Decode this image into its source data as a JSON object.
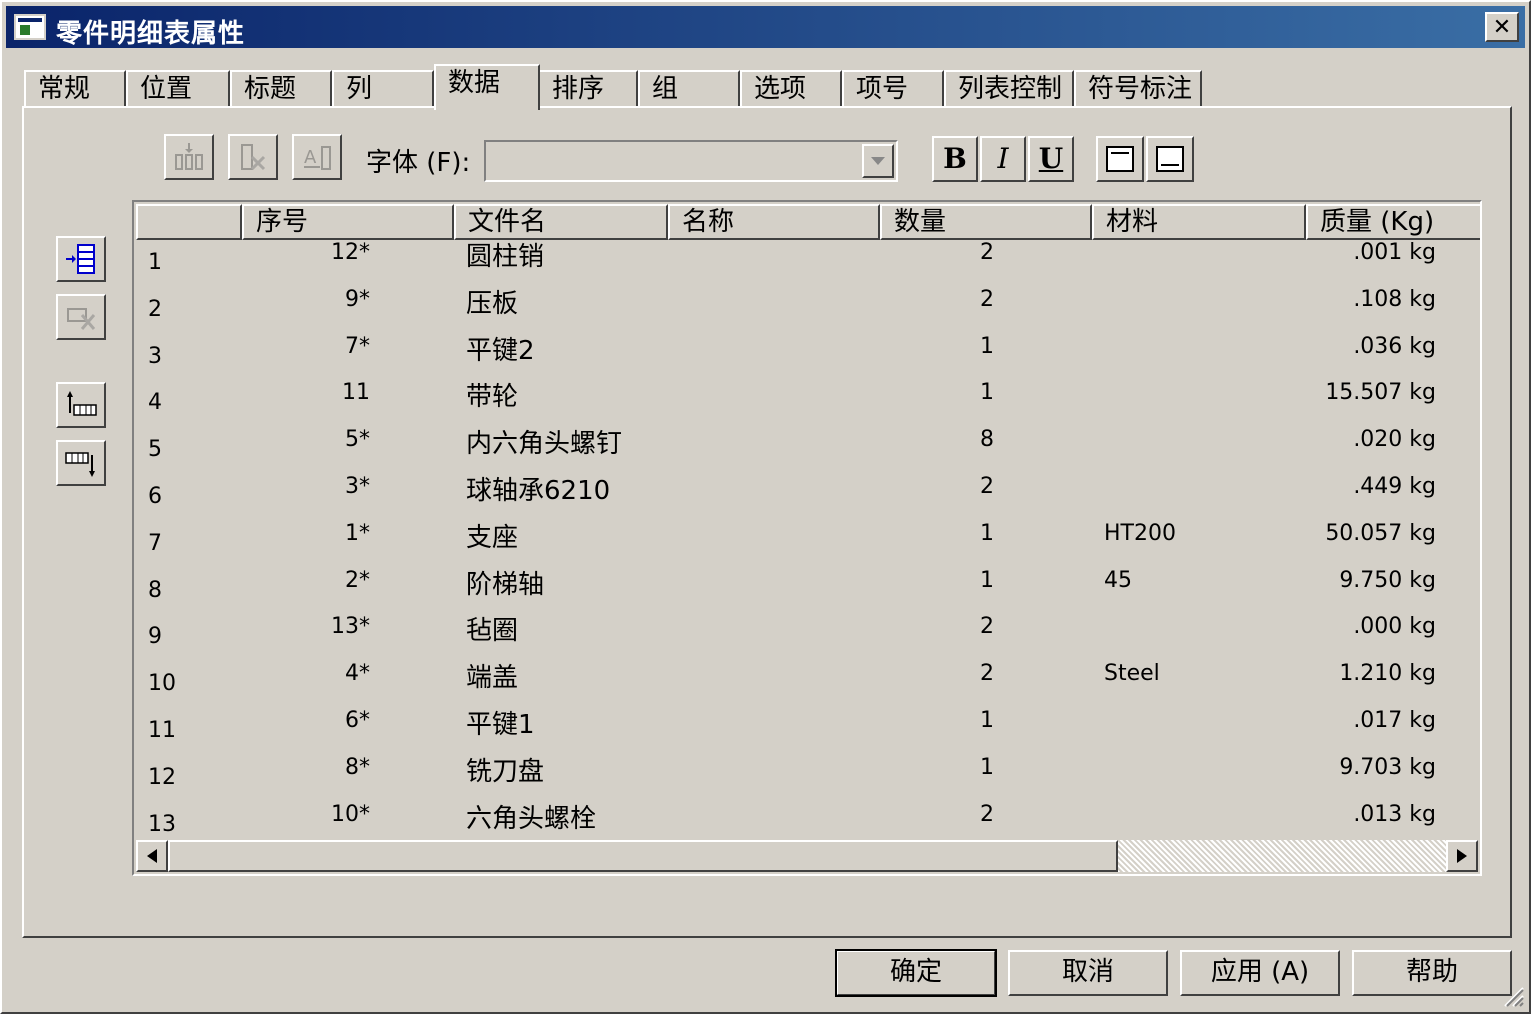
{
  "window": {
    "title": "零件明细表属性",
    "close_label": "✕"
  },
  "tabs": [
    {
      "label": "常规"
    },
    {
      "label": "位置"
    },
    {
      "label": "标题"
    },
    {
      "label": "列"
    },
    {
      "label": "数据",
      "active": true
    },
    {
      "label": "排序"
    },
    {
      "label": "组"
    },
    {
      "label": "选项"
    },
    {
      "label": "项号"
    },
    {
      "label": "列表控制"
    },
    {
      "label": "符号标注"
    }
  ],
  "toolbar": {
    "font_label": "字体 (F):",
    "font_value": "",
    "bold_label": "B",
    "italic_label": "I",
    "underline_label": "U"
  },
  "grid": {
    "columns": [
      "",
      "序号",
      "文件名",
      "名称",
      "数量",
      "材料",
      "质量 (Kg)"
    ],
    "rows": [
      {
        "n": "1",
        "seq": "12*",
        "file": "圆柱销",
        "name": "",
        "qty": "2",
        "mat": "",
        "mass": ".001 kg"
      },
      {
        "n": "2",
        "seq": "9*",
        "file": "压板",
        "name": "",
        "qty": "2",
        "mat": "",
        "mass": ".108 kg"
      },
      {
        "n": "3",
        "seq": "7*",
        "file": "平键2",
        "name": "",
        "qty": "1",
        "mat": "",
        "mass": ".036 kg"
      },
      {
        "n": "4",
        "seq": "11",
        "file": "带轮",
        "name": "",
        "qty": "1",
        "mat": "",
        "mass": "15.507 kg"
      },
      {
        "n": "5",
        "seq": "5*",
        "file": "内六角头螺钉",
        "name": "",
        "qty": "8",
        "mat": "",
        "mass": ".020 kg"
      },
      {
        "n": "6",
        "seq": "3*",
        "file": "球轴承6210",
        "name": "",
        "qty": "2",
        "mat": "",
        "mass": ".449 kg"
      },
      {
        "n": "7",
        "seq": "1*",
        "file": "支座",
        "name": "",
        "qty": "1",
        "mat": "HT200",
        "mass": "50.057 kg"
      },
      {
        "n": "8",
        "seq": "2*",
        "file": "阶梯轴",
        "name": "",
        "qty": "1",
        "mat": "45",
        "mass": "9.750 kg"
      },
      {
        "n": "9",
        "seq": "13*",
        "file": "毡圈",
        "name": "",
        "qty": "2",
        "mat": "",
        "mass": ".000 kg"
      },
      {
        "n": "10",
        "seq": "4*",
        "file": "端盖",
        "name": "",
        "qty": "2",
        "mat": "Steel",
        "mass": "1.210 kg"
      },
      {
        "n": "11",
        "seq": "6*",
        "file": "平键1",
        "name": "",
        "qty": "1",
        "mat": "",
        "mass": ".017 kg"
      },
      {
        "n": "12",
        "seq": "8*",
        "file": "铣刀盘",
        "name": "",
        "qty": "1",
        "mat": "",
        "mass": "9.703 kg"
      },
      {
        "n": "13",
        "seq": "10*",
        "file": "六角头螺栓",
        "name": "",
        "qty": "2",
        "mat": "",
        "mass": ".013 kg"
      }
    ]
  },
  "buttons": {
    "ok": "确定",
    "cancel": "取消",
    "apply": "应用 (A)",
    "help": "帮助"
  },
  "colors": {
    "face": "#d4d0c8",
    "title_start": "#0a246a",
    "title_end": "#3a6ea5"
  },
  "icons": [
    "insert-row-icon",
    "delete-row-icon",
    "insert-column-left-icon",
    "insert-column-right-icon",
    "delete-icon",
    "format-text-icon",
    "align-top-icon",
    "align-bottom-icon",
    "dropdown-arrow-icon",
    "scroll-left-icon",
    "scroll-right-icon"
  ]
}
